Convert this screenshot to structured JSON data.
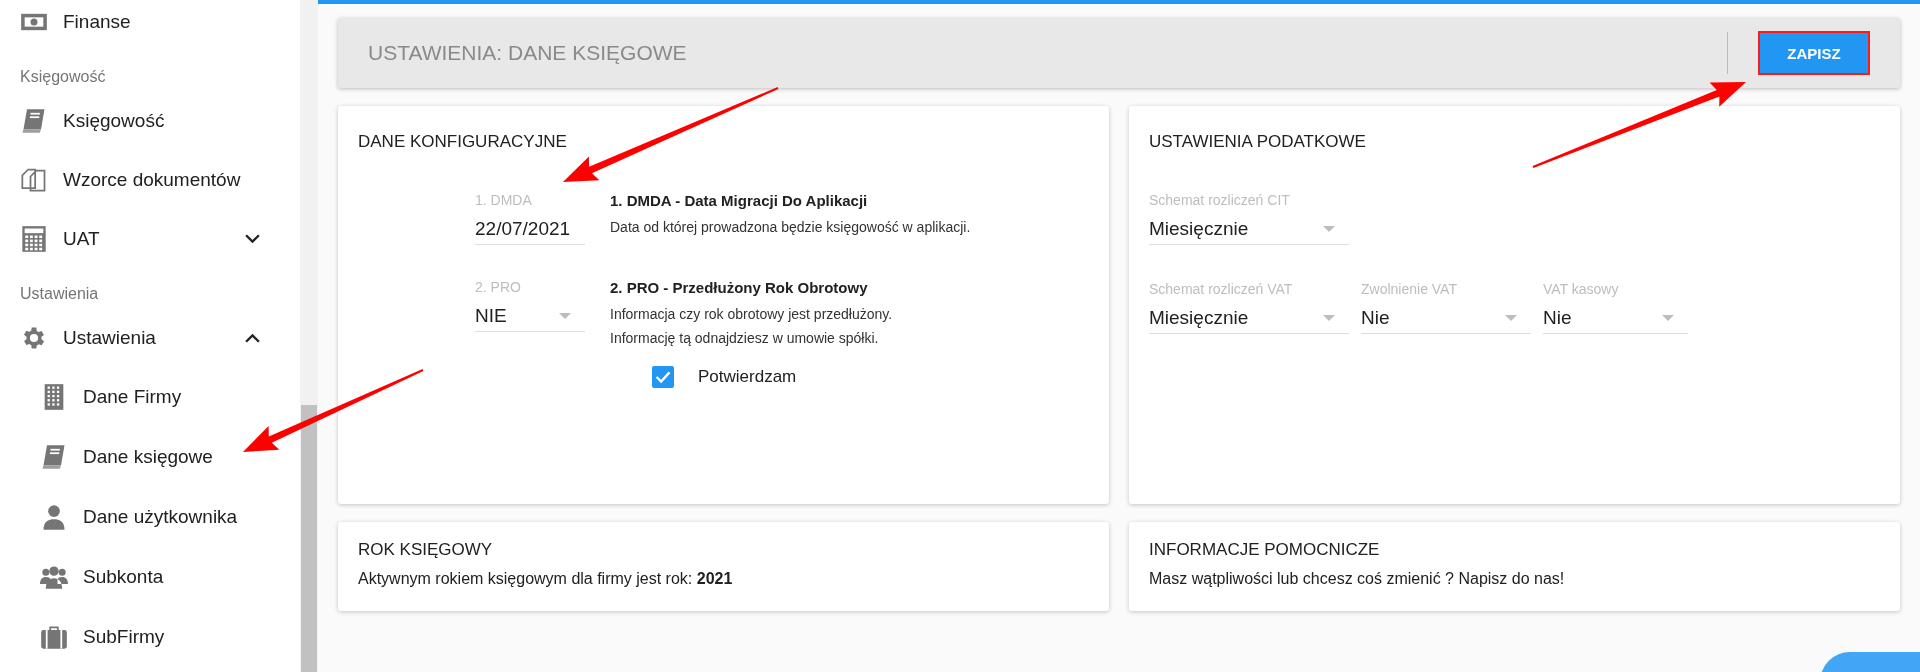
{
  "sidebar": {
    "items": [
      {
        "kind": "item",
        "label": "Finanse"
      },
      {
        "kind": "section",
        "label": "Księgowość"
      },
      {
        "kind": "item",
        "label": "Księgowość"
      },
      {
        "kind": "item",
        "label": "Wzorce dokumentów"
      },
      {
        "kind": "item",
        "label": "UAT",
        "expanded": false
      },
      {
        "kind": "section",
        "label": "Ustawienia"
      },
      {
        "kind": "item",
        "label": "Ustawienia",
        "expanded": true,
        "children": [
          {
            "label": "Dane Firmy"
          },
          {
            "label": "Dane księgowe"
          },
          {
            "label": "Dane użytkownika"
          },
          {
            "label": "Subkonta"
          },
          {
            "label": "SubFirmy"
          }
        ]
      }
    ]
  },
  "header": {
    "title": "USTAWIENIA: DANE KSIĘGOWE",
    "save_button": "ZAPISZ"
  },
  "config_card": {
    "title": "DANE KONFIGURACYJNE",
    "fields": [
      {
        "kind": "date",
        "label": "1. DMDA",
        "value": "22/07/2021",
        "heading": "1. DMDA - Data Migracji Do Aplikacji",
        "description": [
          "Data od której prowadzona będzie księgowość w aplikacji."
        ]
      },
      {
        "kind": "select",
        "label": "2. PRO",
        "value": "NIE",
        "heading": "2. PRO - Przedłużony Rok Obrotowy",
        "description": [
          "Informacja czy rok obrotowy jest przedłużony.",
          "Informację tą odnajdziesz w umowie spółki."
        ]
      }
    ],
    "confirm": {
      "label": "Potwierdzam",
      "checked": true
    }
  },
  "tax_card": {
    "title": "USTAWIENIA PODATKOWE",
    "rows": [
      [
        {
          "label": "Schemat rozliczeń CIT",
          "value": "Miesięcznie"
        }
      ],
      [
        {
          "label": "Schemat rozliczeń VAT",
          "value": "Miesięcznie"
        },
        {
          "label": "Zwolnienie VAT",
          "value": "Nie"
        },
        {
          "label": "VAT kasowy",
          "value": "Nie"
        }
      ]
    ]
  },
  "year_card": {
    "title": "ROK KSIĘGOWY",
    "text": "Aktywnym rokiem księgowym dla firmy jest rok: **2021**"
  },
  "help_card": {
    "title": "INFORMACJE POMOCNICZE",
    "text": "Masz wątpliwości lub chcesz coś zmienić ? Napisz do nas!"
  }
}
